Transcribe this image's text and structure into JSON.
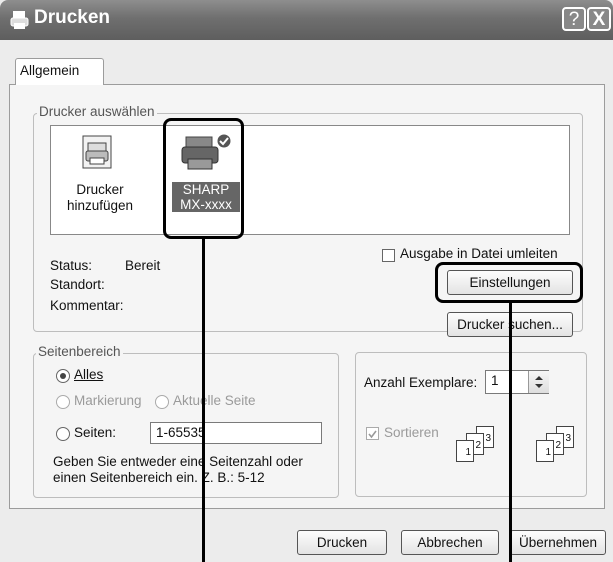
{
  "window": {
    "title": "Drucken",
    "help_btn": "?",
    "close_btn": "X"
  },
  "tab": {
    "label": "Allgemein"
  },
  "printer_select": {
    "legend": "Drucker auswählen",
    "items": [
      {
        "label_line1": "Drucker",
        "label_line2": "hinzufügen"
      },
      {
        "label_line1": "SHARP",
        "label_line2": "MX-xxxx"
      }
    ]
  },
  "status": {
    "status_label": "Status:",
    "status_value": "Bereit",
    "location_label": "Standort:",
    "location_value": "",
    "comment_label": "Kommentar:",
    "comment_value": ""
  },
  "output_to_file": {
    "label": "Ausgabe in Datei umleiten",
    "checked": false
  },
  "buttons": {
    "settings": "Einstellungen",
    "find_printer": "Drucker suchen...",
    "print": "Drucken",
    "cancel": "Abbrechen",
    "apply": "Übernehmen"
  },
  "page_range": {
    "legend": "Seitenbereich",
    "all": "Alles",
    "selection": "Markierung",
    "current_page": "Aktuelle Seite",
    "pages": "Seiten:",
    "pages_value": "1-65535",
    "hint_line1": "Geben Sie entweder eine Seitenzahl oder",
    "hint_line2": "einen Seitenbereich ein. Z. B.: 5-12"
  },
  "copies": {
    "label": "Anzahl Exemplare:",
    "value": "1",
    "collate_label": "Sortieren",
    "collate_checked": true,
    "collate_pages": [
      "1",
      "2",
      "3"
    ]
  },
  "colors": {
    "titlebar": "#6f6f6f",
    "callout": "#000000"
  }
}
